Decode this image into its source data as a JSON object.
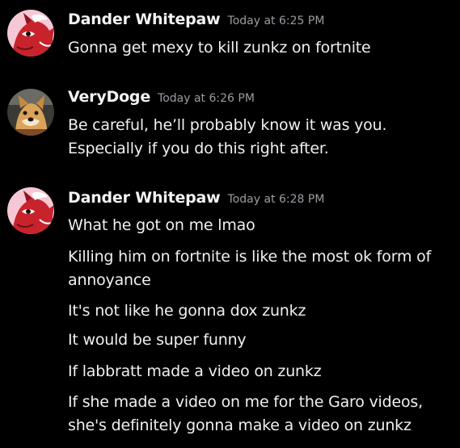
{
  "messages": [
    {
      "username": "Dander Whitepaw",
      "timestamp": "Today at 6:25 PM",
      "avatar": "red-wolf-avatar",
      "lines": [
        "Gonna get mexy to kill zunkz on fortnite"
      ]
    },
    {
      "username": "VeryDoge",
      "timestamp": "Today at 6:26 PM",
      "avatar": "shiba-doge-avatar",
      "lines": [
        "Be careful, he’ll probably know it was you.",
        "Especially if you do this right after."
      ]
    },
    {
      "username": "Dander Whitepaw",
      "timestamp": "Today at 6:28 PM",
      "avatar": "red-wolf-avatar",
      "lines": [
        "What he got on me lmao",
        "Killing him on fortnite is like the most ok form of",
        "annoyance",
        "It's not like he gonna dox zunkz",
        "It would be super funny",
        "If labbratt made a video on zunkz",
        "If she made a video on me for the Garo videos,",
        "she's definitely gonna make a video on zunkz"
      ]
    }
  ],
  "colors": {
    "background": "#000000",
    "username": "#f2f3f5",
    "timestamp": "#9a9ca2",
    "message_text": "#eef0f2"
  }
}
